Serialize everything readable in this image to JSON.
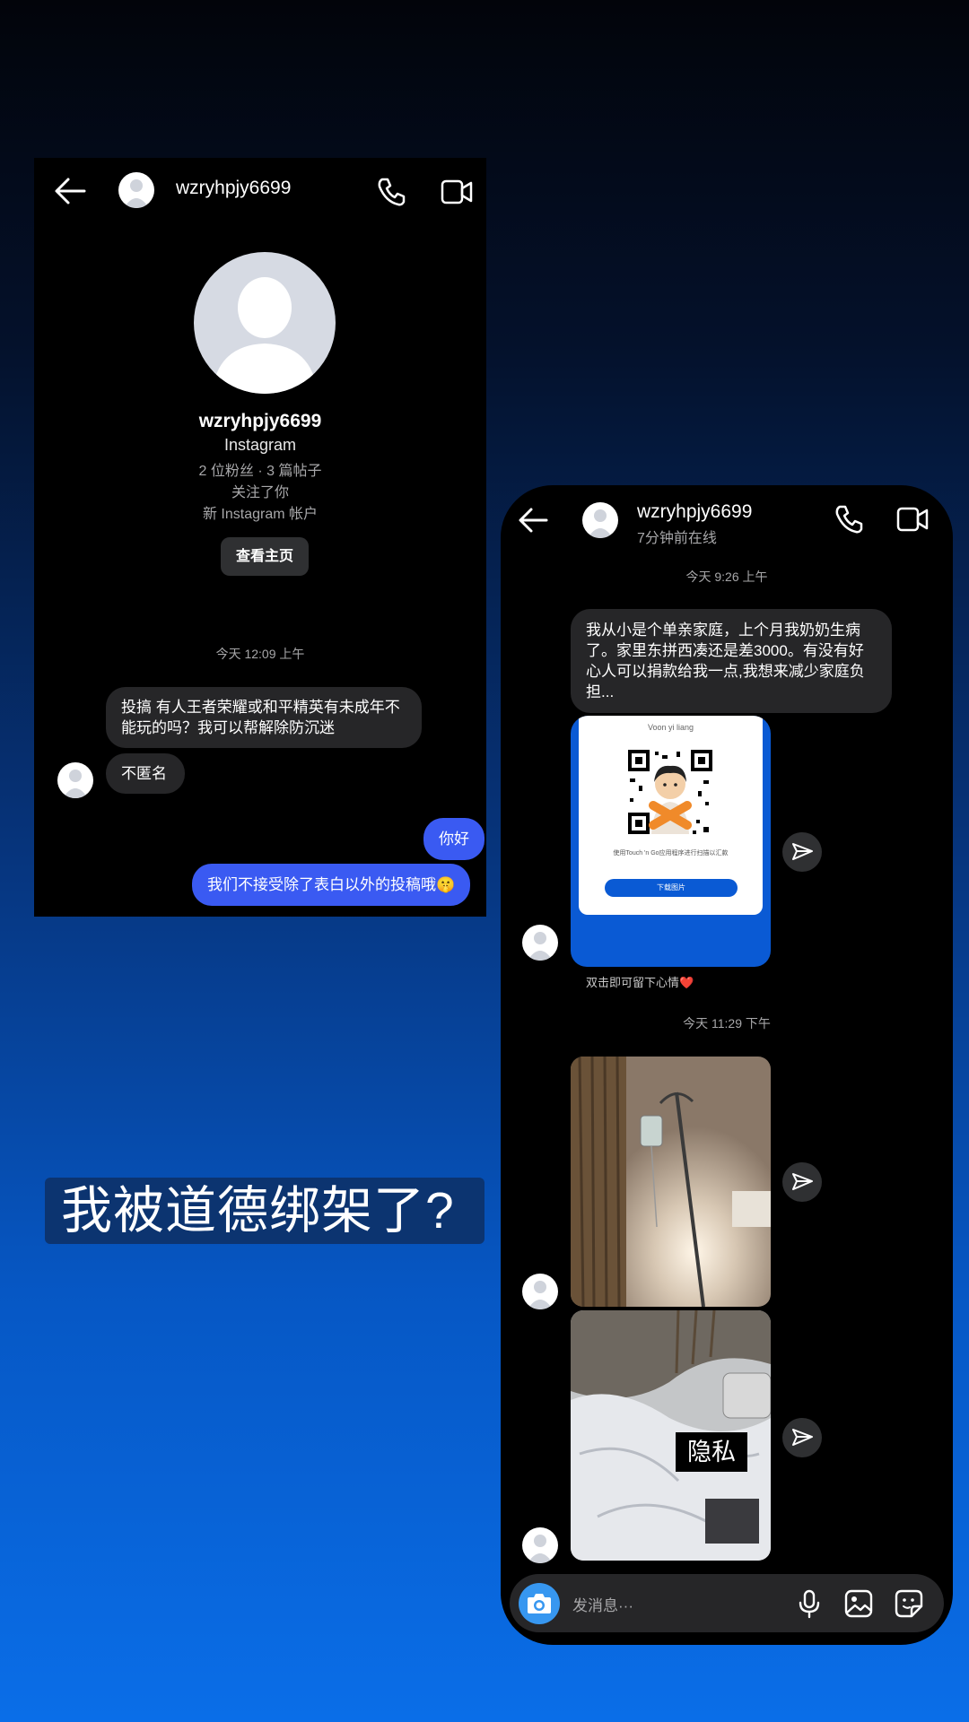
{
  "left": {
    "username": "wzryhpjy6699",
    "profile": {
      "name": "wzryhpjy6699",
      "platform": "Instagram",
      "stats": "2 位粉丝 · 3 篇帖子",
      "relation": "关注了你",
      "account_note": "新 Instagram 帐户",
      "view_button": "查看主页"
    },
    "timestamp": "今天 12:09 上午",
    "messages_in": [
      "投搞  有人王者荣耀或和平精英有未成年不能玩的吗？我可以帮解除防沉迷",
      "不匿名"
    ],
    "messages_out": [
      "你好",
      "我们不接受除了表白以外的投稿哦🤫"
    ],
    "icons": [
      "arrow-left-icon",
      "phone-icon",
      "video-camera-icon"
    ]
  },
  "right": {
    "username": "wzryhpjy6699",
    "status": "7分钟前在线",
    "timestamp1": "今天 9:26 上午",
    "message": "我从小是个单亲家庭，上个月我奶奶生病了。家里东拼西凑还是差3000。有没有好心人可以捐款给我一点,我想来减少家庭负担...",
    "card": {
      "title": "Voon yi liang",
      "caption": "使用Touch 'n Go应用程序进行扫描以汇款",
      "button": "下载图片"
    },
    "hint": "双击即可留下心情❤️",
    "timestamp2": "今天 11:29 下午",
    "privacy_label": "隐私",
    "composer_placeholder": "发消息···",
    "icons": [
      "arrow-left-icon",
      "phone-icon",
      "video-camera-icon",
      "send-icon",
      "camera-icon",
      "microphone-icon",
      "gallery-icon",
      "sticker-icon"
    ]
  },
  "overlay_title": "我被道德绑架了?",
  "colors": {
    "outgoing_bubble": "#3a5af2",
    "incoming_bubble": "#262628",
    "camera_button": "#3797f0",
    "tng_blue": "#0a5ad4"
  }
}
